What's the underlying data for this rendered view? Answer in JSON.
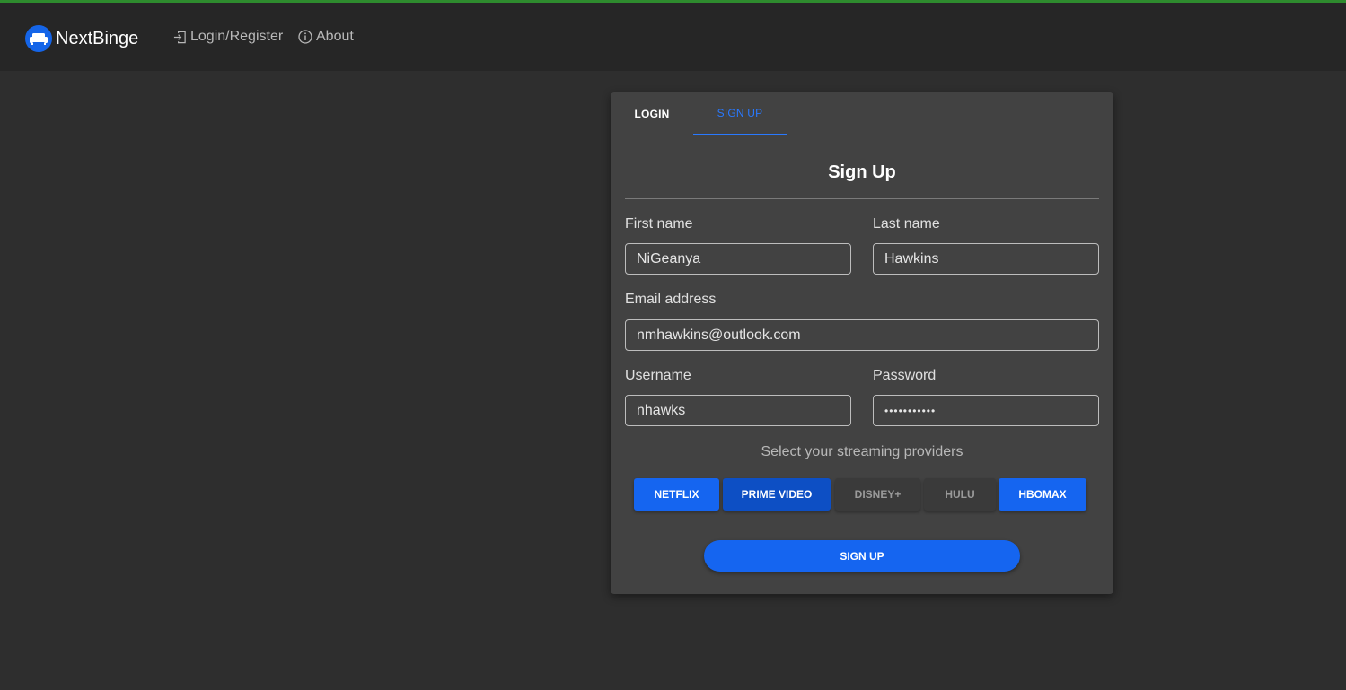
{
  "app": {
    "brand_name": "NextBinge",
    "nav": {
      "login_register": "Login/Register",
      "about": "About"
    }
  },
  "tabs": [
    {
      "label": "LOGIN",
      "active": false
    },
    {
      "label": "SIGN UP",
      "active": true
    }
  ],
  "form": {
    "title": "Sign Up",
    "first_name": {
      "label": "First name",
      "value": "NiGeanya"
    },
    "last_name": {
      "label": "Last name",
      "value": "Hawkins"
    },
    "email": {
      "label": "Email address",
      "value": "nmhawkins@outlook.com"
    },
    "username": {
      "label": "Username",
      "value": "nhawks"
    },
    "password": {
      "label": "Password",
      "value": "•••••••••••"
    },
    "providers_title": "Select your streaming providers",
    "providers": [
      {
        "label": "NETFLIX",
        "selected": true
      },
      {
        "label": "PRIME VIDEO",
        "selected": true
      },
      {
        "label": "DISNEY+",
        "selected": false
      },
      {
        "label": "HULU",
        "selected": false
      },
      {
        "label": "HBOMAX",
        "selected": true
      }
    ],
    "submit_label": "SIGN UP"
  },
  "colors": {
    "accent": "#1565f0",
    "tab_active": "#2979ff",
    "background": "#2e2e2e",
    "navbar": "#262626",
    "card": "#424242"
  }
}
